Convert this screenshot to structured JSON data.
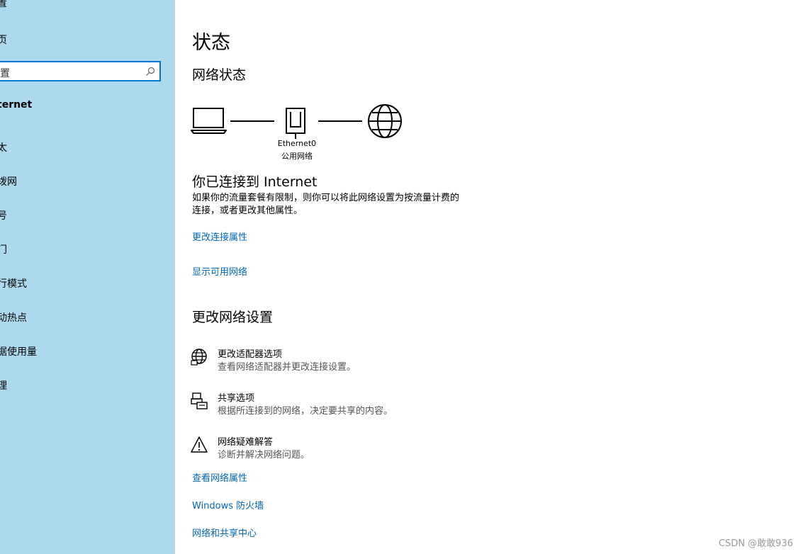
{
  "sidebar": {
    "items": [
      {
        "label": "置"
      },
      {
        "label": "页"
      },
      {
        "label": "ternet"
      },
      {
        "label": "太"
      },
      {
        "label": "拨网"
      },
      {
        "label": "号"
      },
      {
        "label": "门"
      },
      {
        "label": "行模式"
      },
      {
        "label": "动热点"
      },
      {
        "label": "据使用量"
      },
      {
        "label": "理"
      }
    ],
    "search_placeholder": "置"
  },
  "main": {
    "page_title": "状态",
    "network_status_heading": "网络状态",
    "diagram": {
      "adapter_name": "Ethernet0",
      "network_type": "公用网络"
    },
    "connected_title": "你已连接到 Internet",
    "connected_desc_line1": "如果你的流量套餐有限制，则你可以将此网络设置为按流量计费的",
    "connected_desc_line2": "连接，或者更改其他属性。",
    "link_change_connection": "更改连接属性",
    "link_show_networks": "显示可用网络",
    "change_settings_heading": "更改网络设置",
    "settings_items": [
      {
        "title": "更改适配器选项",
        "desc": "查看网络适配器并更改连接设置。",
        "icon": "globe-adapter-icon"
      },
      {
        "title": "共享选项",
        "desc": "根据所连接到的网络，决定要共享的内容。",
        "icon": "sharing-icon"
      },
      {
        "title": "网络疑难解答",
        "desc": "诊断并解决网络问题。",
        "icon": "warning-icon"
      }
    ],
    "link_view_properties": "查看网络属性",
    "link_firewall": "Windows 防火墙",
    "link_sharing_center": "网络和共享中心"
  },
  "watermark": "CSDN @敢敢936",
  "colors": {
    "sidebar_bg": "#add9ee",
    "accent": "#0078d7",
    "link": "#0067b8"
  }
}
